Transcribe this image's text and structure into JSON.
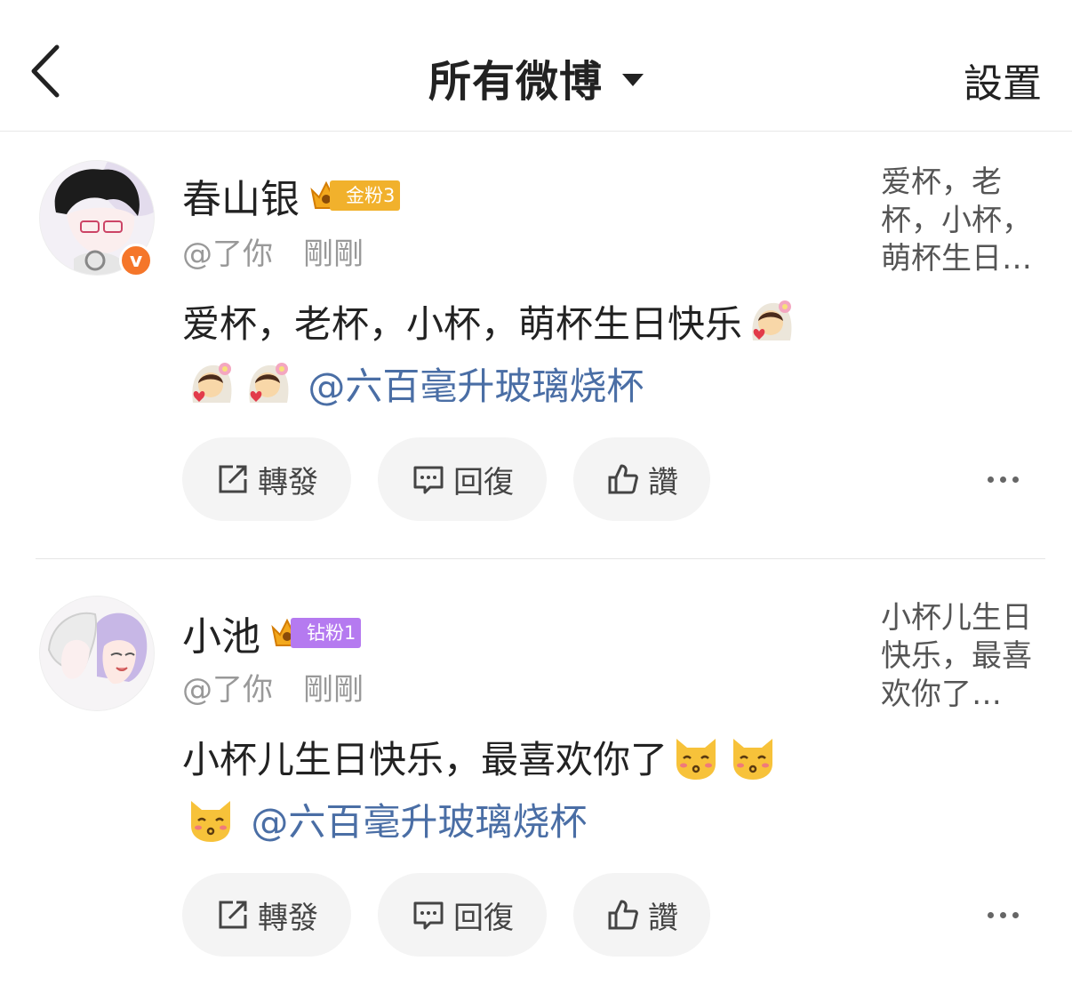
{
  "header": {
    "title": "所有微博",
    "settings_label": "設置"
  },
  "posts": [
    {
      "user_name": "春山银",
      "fan_badge": "金粉3",
      "fan_badge_color": "#f1b12c",
      "handle": "@了你",
      "time": "剛剛",
      "content_text": "爱杯，老杯，小杯，萌杯生日快乐",
      "emoji_icon": "bride-emoji",
      "mention": "@六百毫升玻璃烧杯",
      "preview": "爱杯，老杯，小杯，萌杯生日…",
      "actions": {
        "repost": "轉發",
        "reply": "回復",
        "like": "讚"
      }
    },
    {
      "user_name": "小池",
      "fan_badge": "钻粉1",
      "fan_badge_color": "#b57af0",
      "handle": "@了你",
      "time": "剛剛",
      "content_text": "小杯儿生日快乐，最喜欢你了",
      "emoji_icon": "kissing-cat-emoji",
      "mention": "@六百毫升玻璃烧杯",
      "preview": "小杯儿生日快乐，最喜欢你了…",
      "actions": {
        "repost": "轉發",
        "reply": "回復",
        "like": "讚"
      }
    }
  ]
}
